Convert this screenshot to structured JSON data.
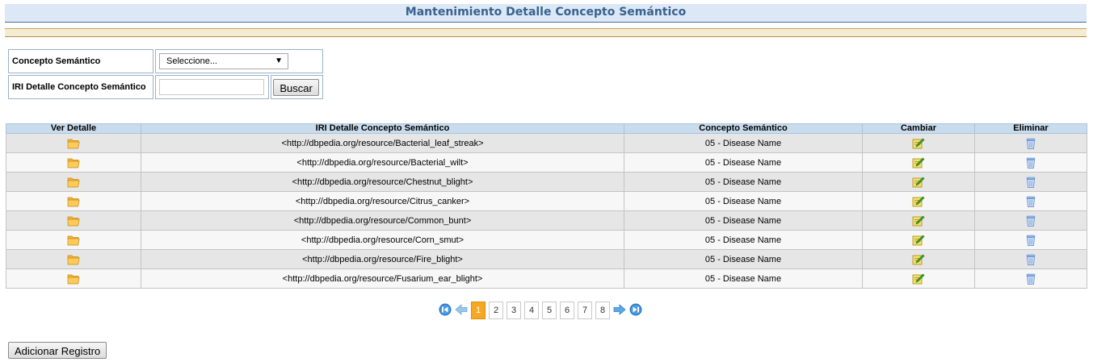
{
  "page_title": "Mantenimiento Detalle Concepto Semántico",
  "form": {
    "concepto_label": "Concepto Semántico",
    "concepto_value": "Seleccione...",
    "iri_label": "IRI Detalle Concepto Semántico",
    "iri_value": "",
    "buscar_label": "Buscar"
  },
  "grid": {
    "headers": [
      "Ver Detalle",
      "IRI Detalle Concepto Semántico",
      "Concepto Semántico",
      "Cambiar",
      "Eliminar"
    ],
    "rows": [
      {
        "iri": "<http://dbpedia.org/resource/Bacterial_leaf_streak>",
        "concepto": "05 - Disease Name"
      },
      {
        "iri": "<http://dbpedia.org/resource/Bacterial_wilt>",
        "concepto": "05 - Disease Name"
      },
      {
        "iri": "<http://dbpedia.org/resource/Chestnut_blight>",
        "concepto": "05 - Disease Name"
      },
      {
        "iri": "<http://dbpedia.org/resource/Citrus_canker>",
        "concepto": "05 - Disease Name"
      },
      {
        "iri": "<http://dbpedia.org/resource/Common_bunt>",
        "concepto": "05 - Disease Name"
      },
      {
        "iri": "<http://dbpedia.org/resource/Corn_smut>",
        "concepto": "05 - Disease Name"
      },
      {
        "iri": "<http://dbpedia.org/resource/Fire_blight>",
        "concepto": "05 - Disease Name"
      },
      {
        "iri": "<http://dbpedia.org/resource/Fusarium_ear_blight>",
        "concepto": "05 - Disease Name"
      }
    ],
    "icons": {
      "ver": "folder-icon",
      "cambiar": "edit-icon",
      "eliminar": "trash-icon"
    }
  },
  "pagination": {
    "pages": [
      "1",
      "2",
      "3",
      "4",
      "5",
      "6",
      "7",
      "8"
    ],
    "current": "1",
    "icons": {
      "first": "first-page-icon",
      "prev": "prev-page-icon",
      "next": "next-page-icon",
      "last": "last-page-icon"
    }
  },
  "add_button_label": "Adicionar Registro",
  "colors": {
    "title_text": "#38628f",
    "header_bg": "#c9dcee",
    "active_page": "#f6a823"
  }
}
